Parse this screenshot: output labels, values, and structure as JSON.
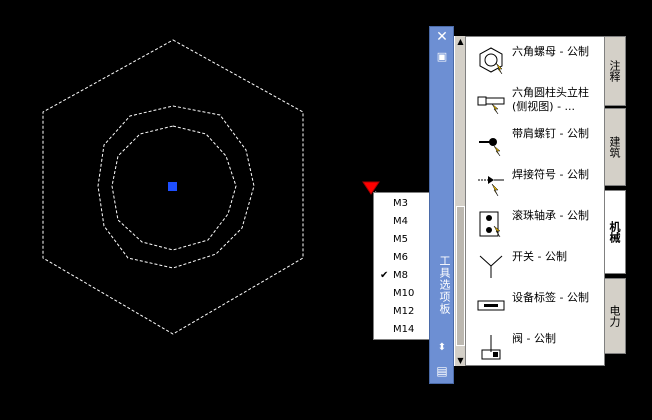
{
  "palette": {
    "title": "工具选项板",
    "close_icon": "close-icon",
    "tools": [
      {
        "label": "六角螺母 - 公制",
        "icon": "hex-nut-icon"
      },
      {
        "label": "六角圆柱头立柱(侧视图) - ...",
        "icon": "hex-bolt-side-icon"
      },
      {
        "label": "带肩螺钉 - 公制",
        "icon": "shoulder-screw-icon"
      },
      {
        "label": "焊接符号 - 公制",
        "icon": "welding-symbol-icon"
      },
      {
        "label": "滚珠轴承 - 公制",
        "icon": "ball-bearing-icon"
      },
      {
        "label": "开关 - 公制",
        "icon": "switch-icon"
      },
      {
        "label": "设备标签 - 公制",
        "icon": "equipment-tag-icon"
      },
      {
        "label": "阀 - 公制",
        "icon": "valve-icon"
      }
    ],
    "tabs": [
      "注释",
      "建筑",
      "机械",
      "电力"
    ],
    "active_tab": "机械"
  },
  "size_menu": {
    "items": [
      "M3",
      "M4",
      "M5",
      "M6",
      "M8",
      "M10",
      "M12",
      "M14"
    ],
    "selected": "M8"
  },
  "colors": {
    "grip": "#1e4fff",
    "marker": "#ff0000",
    "palette_title": "#6d8fd3"
  }
}
